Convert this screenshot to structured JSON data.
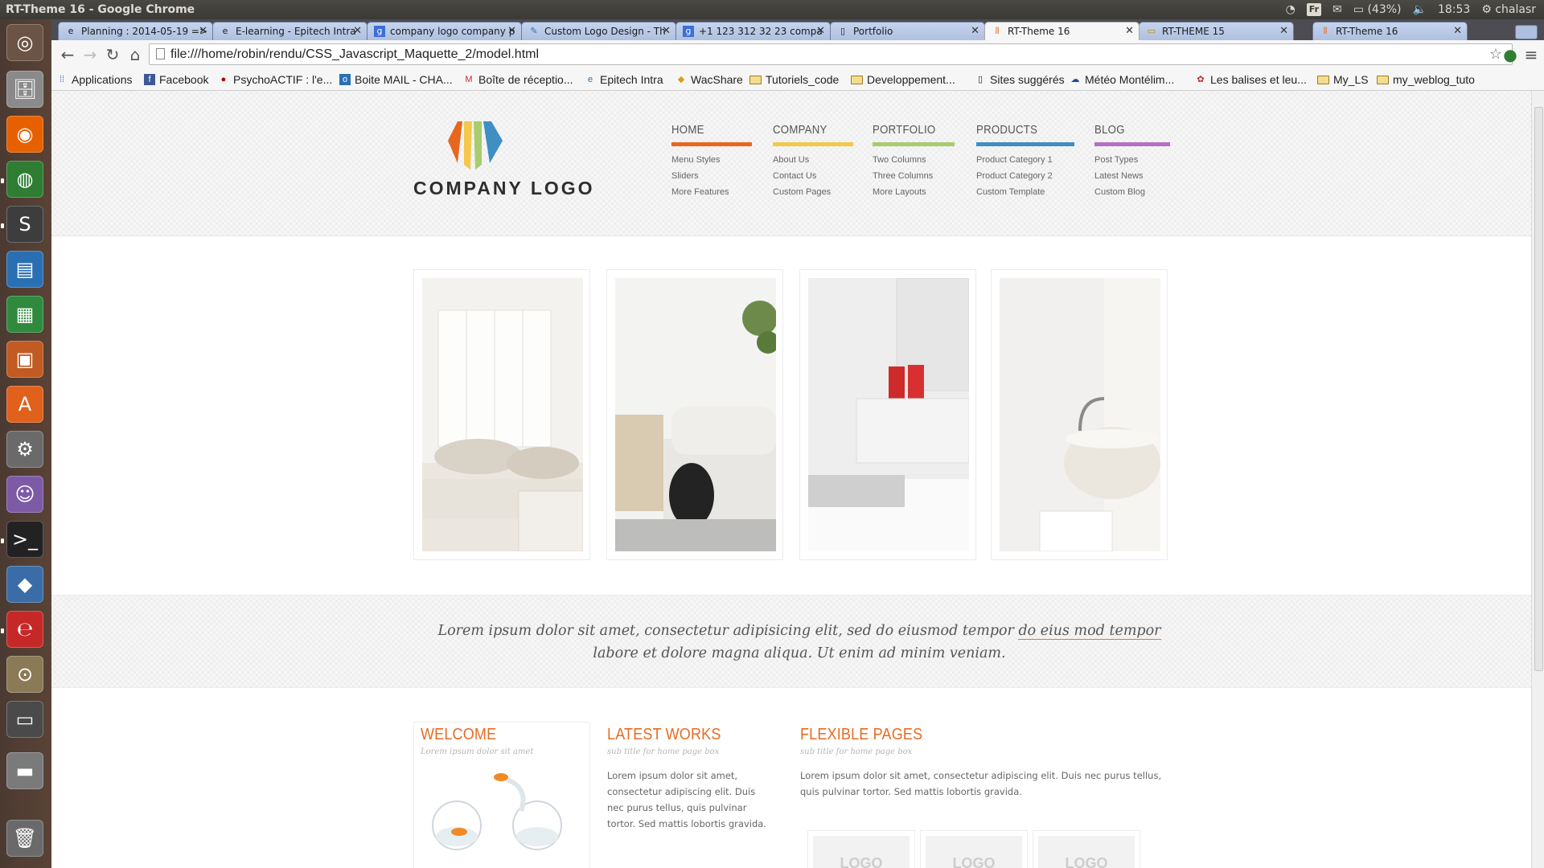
{
  "panel": {
    "window_title": "RT-Theme 16 - Google Chrome",
    "keyboard_layout": "Fr",
    "battery": "(43%)",
    "time": "18:53",
    "user": "chalasr"
  },
  "tabs": [
    {
      "title": "Planning : 2014-05-19 =>",
      "favicon": "epitech-icon"
    },
    {
      "title": "E-learning - Epitech Intra",
      "favicon": "epitech-icon"
    },
    {
      "title": "company logo company p",
      "favicon": "google-icon"
    },
    {
      "title": "Custom Logo Design - Th",
      "favicon": "logo-icon"
    },
    {
      "title": "+1 123 312 32 23 compa",
      "favicon": "google-icon"
    },
    {
      "title": "Portfolio",
      "favicon": "page-icon"
    },
    {
      "title": "RT-Theme 16",
      "favicon": "rt-icon",
      "active": true
    },
    {
      "title": "RT-THEME 15",
      "favicon": "rt-icon"
    },
    {
      "title": "RT-Theme 16",
      "favicon": "rt-icon"
    }
  ],
  "address": {
    "url": "file:///home/robin/rendu/CSS_Javascript_Maquette_2/model.html"
  },
  "bookmarks": [
    {
      "label": "Applications",
      "icon": "apps-grid-icon"
    },
    {
      "label": "Facebook",
      "icon": "facebook-icon"
    },
    {
      "label": "PsychoACTIF : l'e...",
      "icon": "psycho-icon"
    },
    {
      "label": "Boite MAIL - CHA...",
      "icon": "outlook-icon"
    },
    {
      "label": "Boîte de réceptio...",
      "icon": "gmail-icon"
    },
    {
      "label": "Epitech Intra",
      "icon": "epitech-icon"
    },
    {
      "label": "WacShare",
      "icon": "wacshare-icon"
    },
    {
      "label": "Tutoriels_code",
      "icon": "folder-icon"
    },
    {
      "label": "Developpement...",
      "icon": "folder-icon"
    },
    {
      "label": "Sites suggérés",
      "icon": "page-icon"
    },
    {
      "label": "Météo Montélim...",
      "icon": "weather-icon"
    },
    {
      "label": "Les balises et leu...",
      "icon": "balises-icon"
    },
    {
      "label": "My_LS",
      "icon": "folder-icon"
    },
    {
      "label": "my_weblog_tuto",
      "icon": "folder-icon"
    }
  ],
  "site": {
    "logo_text": "COMPANY LOGO",
    "nav": [
      {
        "label": "HOME",
        "color": "#e8671f",
        "items": [
          "Menu Styles",
          "Sliders",
          "More Features"
        ]
      },
      {
        "label": "COMPANY",
        "color": "#f3c84b",
        "items": [
          "About Us",
          "Contact Us",
          "Custom Pages"
        ]
      },
      {
        "label": "PORTFOLIO",
        "color": "#a8cc6e",
        "items": [
          "Two Columns",
          "Three Columns",
          "More Layouts"
        ]
      },
      {
        "label": "PRODUCTS",
        "color": "#3f8fc2",
        "items": [
          "Product Category 1",
          "Product Category 2",
          "Custom Template"
        ]
      },
      {
        "label": "BLOG",
        "color": "#b56fc6",
        "items": [
          "Post Types",
          "Latest News",
          "Custom Blog"
        ]
      }
    ],
    "quote": {
      "before": "Lorem ipsum dolor sit amet, consectetur adipisicing elit, sed do eiusmod tempor ",
      "link": "do eius mod tempor",
      "after": " labore et dolore magna aliqua. Ut enim ad minim veniam."
    },
    "boxes": [
      {
        "title": "WELCOME",
        "subtitle": "Lorem ipsum dolor sit amet",
        "text": ""
      },
      {
        "title": "LATEST WORKS",
        "subtitle": "sub title for home page box",
        "text": "Lorem ipsum dolor sit amet, consectetur adipiscing elit. Duis nec purus tellus, quis pulvinar tortor. Sed mattis lobortis gravida."
      },
      {
        "title": "FLEXIBLE PAGES",
        "subtitle": "sub title for home page box",
        "text": "Lorem ipsum dolor sit amet, consectetur adipiscing elit. Duis nec purus tellus, quis pulvinar tortor. Sed mattis lobortis gravida."
      }
    ],
    "logo_boxes": [
      "LOGO",
      "LOGO",
      "LOGO"
    ]
  }
}
